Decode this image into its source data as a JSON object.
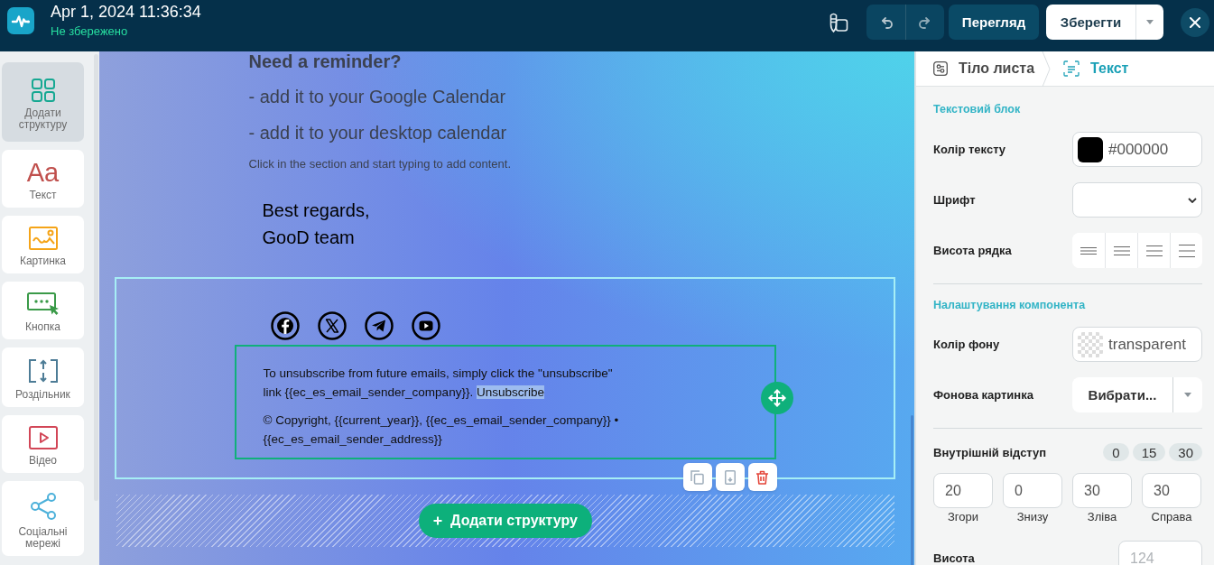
{
  "top_bar": {
    "title": "Apr 1, 2024 11:36:34",
    "save_status": "Не збережено",
    "preview_button": "Перегляд",
    "save_button": "Зберегти"
  },
  "sidebar": {
    "items": [
      {
        "kind": "structure",
        "label": "Додати структуру",
        "selected": true
      },
      {
        "kind": "text",
        "glyph": "Aa",
        "label": "Текст",
        "selected": false
      },
      {
        "kind": "image",
        "label": "Картинка",
        "selected": false
      },
      {
        "kind": "button",
        "label": "Кнопка",
        "selected": false
      },
      {
        "kind": "divider",
        "label": "Роздільник",
        "selected": false
      },
      {
        "kind": "video",
        "label": "Відео",
        "selected": false
      },
      {
        "kind": "social",
        "label": "Соціальні мережі",
        "selected": false
      }
    ]
  },
  "canvas": {
    "heading": "Need a reminder?",
    "list_items": [
      "- add it to your Google Calendar",
      "- add it to your desktop calendar"
    ],
    "hint": "Click in the section and start typing to add content.",
    "signature_lines": [
      "Best regards,",
      "GooD team"
    ],
    "social_links": [
      {
        "kind": "facebook"
      },
      {
        "kind": "x"
      },
      {
        "kind": "telegram"
      },
      {
        "kind": "youtube"
      }
    ],
    "footer": {
      "unsubscribe_text": "To unsubscribe from future emails, simply click the \"unsubscribe\" link {{ec_es_email_sender_company}}.",
      "unsubscribe_link": {
        "text": "Unsubscribe",
        "highlighted": true
      },
      "copyright": "© Copyright, {{current_year}}, {{ec_es_email_sender_company}} • {{ec_es_email_sender_address}}"
    },
    "add_structure_button": "Додати структуру"
  },
  "properties_panel": {
    "breadcrumbs": [
      {
        "kind": "email_body",
        "label": "Тіло листа",
        "selected": false
      },
      {
        "kind": "text",
        "label": "Текст",
        "selected": true
      }
    ],
    "text_block": {
      "title": "Текстовий блок",
      "text_color": {
        "label": "Колір тексту",
        "value": "#000000"
      },
      "font": {
        "label": "Шрифт"
      },
      "line_height": {
        "label": "Висота рядка",
        "options": [
          {
            "kind": "tight"
          },
          {
            "kind": "normal"
          },
          {
            "kind": "relaxed"
          },
          {
            "kind": "loose"
          }
        ]
      }
    },
    "component_settings": {
      "title": "Налаштування компонента",
      "background_color": {
        "label": "Колір фону",
        "value": "transparent"
      },
      "background_image": {
        "label": "Фонова картинка",
        "button": "Вибрати..."
      },
      "padding": {
        "label": "Внутрішній відступ",
        "presets": [
          "0",
          "15",
          "30"
        ],
        "fields": [
          {
            "label": "Згори",
            "value": "20"
          },
          {
            "label": "Знизу",
            "value": "0"
          },
          {
            "label": "Зліва",
            "value": "30"
          },
          {
            "label": "Справа",
            "value": "30"
          }
        ]
      },
      "height": {
        "label": "Висота",
        "placeholder": "124"
      }
    }
  }
}
